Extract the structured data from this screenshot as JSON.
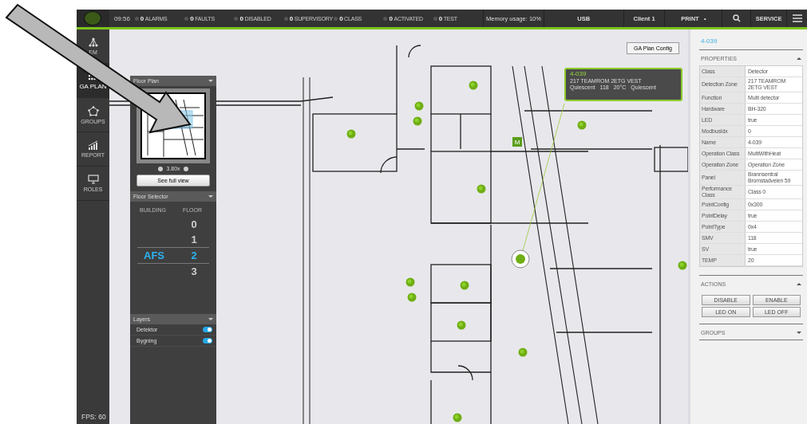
{
  "topbar": {
    "time": "09:56",
    "counters": [
      {
        "count": "0",
        "label": "ALARMS"
      },
      {
        "count": "0",
        "label": "FAULTS"
      },
      {
        "count": "0",
        "label": "DISABLED"
      },
      {
        "count": "0",
        "label": "SUPERVISORY"
      },
      {
        "count": "0",
        "label": "CLASS"
      },
      {
        "count": "0",
        "label": "ACTIVATED"
      },
      {
        "count": "0",
        "label": "TEST"
      }
    ],
    "memory": "Memory usage: 10%",
    "usb": "USB",
    "client": "Client 1",
    "print": "PRINT",
    "print_mark": "•",
    "service": "SERVICE"
  },
  "sidebar": {
    "items": [
      {
        "label": "EM",
        "kind": "network",
        "selected": false
      },
      {
        "label": "GA PLAN",
        "kind": "grid",
        "selected": true
      },
      {
        "label": "GROUPS",
        "kind": "pentagon",
        "selected": false
      },
      {
        "label": "REPORT",
        "kind": "chart",
        "selected": false
      },
      {
        "label": "ROLES",
        "kind": "monitor",
        "selected": false
      }
    ],
    "fps": "FPS: 60"
  },
  "floor_plan_panel": {
    "title": "Floor Plan",
    "zoom": "3.80x",
    "button": "See full view"
  },
  "floor_selector": {
    "title": "Floor Selector",
    "building_heading": "BUILDING",
    "floor_heading": "FLOOR",
    "floors": [
      {
        "floor": "0",
        "selected": false
      },
      {
        "floor": "1",
        "selected": false
      },
      {
        "building": "AFS",
        "floor": "2",
        "selected": true
      },
      {
        "floor": "3",
        "selected": false
      }
    ]
  },
  "layers": {
    "title": "Layers",
    "items": [
      {
        "label": "Detektor",
        "on": true
      },
      {
        "label": "Bygning",
        "on": true
      }
    ]
  },
  "map": {
    "config_button": "GA Plan Config",
    "marker": "M",
    "tooltip": {
      "title": "4-039",
      "zone": "217 TEAMROM 2ETG VEST",
      "status": [
        "Quiescent",
        "118",
        "20°C",
        "Quiescent"
      ]
    }
  },
  "details": {
    "title": "4-039",
    "properties_heading": "PROPERTIES",
    "properties": [
      {
        "name": "Class",
        "value": "Detector"
      },
      {
        "name": "Detection Zone",
        "value": "217 TEAMROM 2ETG VEST"
      },
      {
        "name": "Function",
        "value": "Multi detector"
      },
      {
        "name": "Hardware",
        "value": "BH-320"
      },
      {
        "name": "LED",
        "value": "true"
      },
      {
        "name": "ModbusIdx",
        "value": "0"
      },
      {
        "name": "Name",
        "value": "4-039"
      },
      {
        "name": "Operation Class",
        "value": "MultiWithHeat"
      },
      {
        "name": "Operation Zone",
        "value": "Operation Zone"
      },
      {
        "name": "Panel",
        "value": "Brannsentral Bromstadveien 59"
      },
      {
        "name": "Performance Class",
        "value": "Class 0"
      },
      {
        "name": "PointConfig",
        "value": "0x300"
      },
      {
        "name": "PointDelay",
        "value": "true"
      },
      {
        "name": "PointType",
        "value": "0x4"
      },
      {
        "name": "SMV",
        "value": "118"
      },
      {
        "name": "SV",
        "value": "true"
      },
      {
        "name": "TEMP",
        "value": "20"
      }
    ],
    "actions_heading": "ACTIONS",
    "actions": [
      "DISABLE",
      "ENABLE",
      "LED ON",
      "LED OFF"
    ],
    "groups_heading": "GROUPS"
  }
}
